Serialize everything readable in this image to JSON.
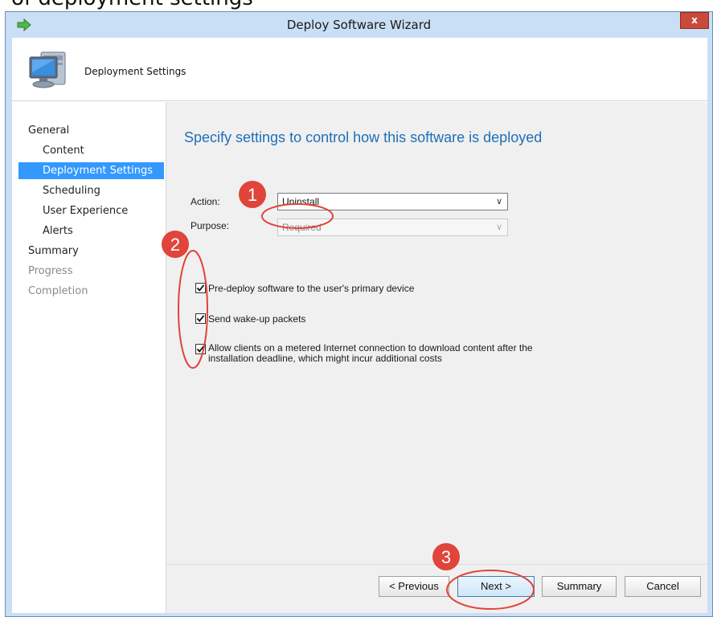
{
  "crop_caption": "of deployment settings",
  "window": {
    "title": "Deploy Software Wizard",
    "close_label": "x"
  },
  "header": {
    "title": "Deployment Settings"
  },
  "sidebar": {
    "items": [
      {
        "label": "General"
      },
      {
        "label": "Content"
      },
      {
        "label": "Deployment Settings"
      },
      {
        "label": "Scheduling"
      },
      {
        "label": "User Experience"
      },
      {
        "label": "Alerts"
      },
      {
        "label": "Summary"
      },
      {
        "label": "Progress"
      },
      {
        "label": "Completion"
      }
    ]
  },
  "content": {
    "heading": "Specify settings to control how this software is deployed",
    "action_label": "Action:",
    "action_value": "Uninstall",
    "purpose_label": "Purpose:",
    "purpose_value": "Required",
    "checkboxes": [
      {
        "label": "Pre-deploy software to the user's primary device",
        "checked": true
      },
      {
        "label": "Send wake-up packets",
        "checked": true
      },
      {
        "label_line1": "Allow clients on a metered Internet connection to download content after the",
        "label_line2": "installation deadline, which might incur additional costs",
        "checked": true
      }
    ]
  },
  "buttons": {
    "previous": "< Previous",
    "next": "Next >",
    "summary": "Summary",
    "cancel": "Cancel"
  },
  "annotations": {
    "markers": [
      "1",
      "2",
      "3"
    ],
    "color": "#e0443a"
  },
  "colors": {
    "title_bar": "#c9dff5",
    "selected_nav": "#3399ff",
    "heading": "#1f6fb8",
    "annotation": "#e0443a"
  }
}
